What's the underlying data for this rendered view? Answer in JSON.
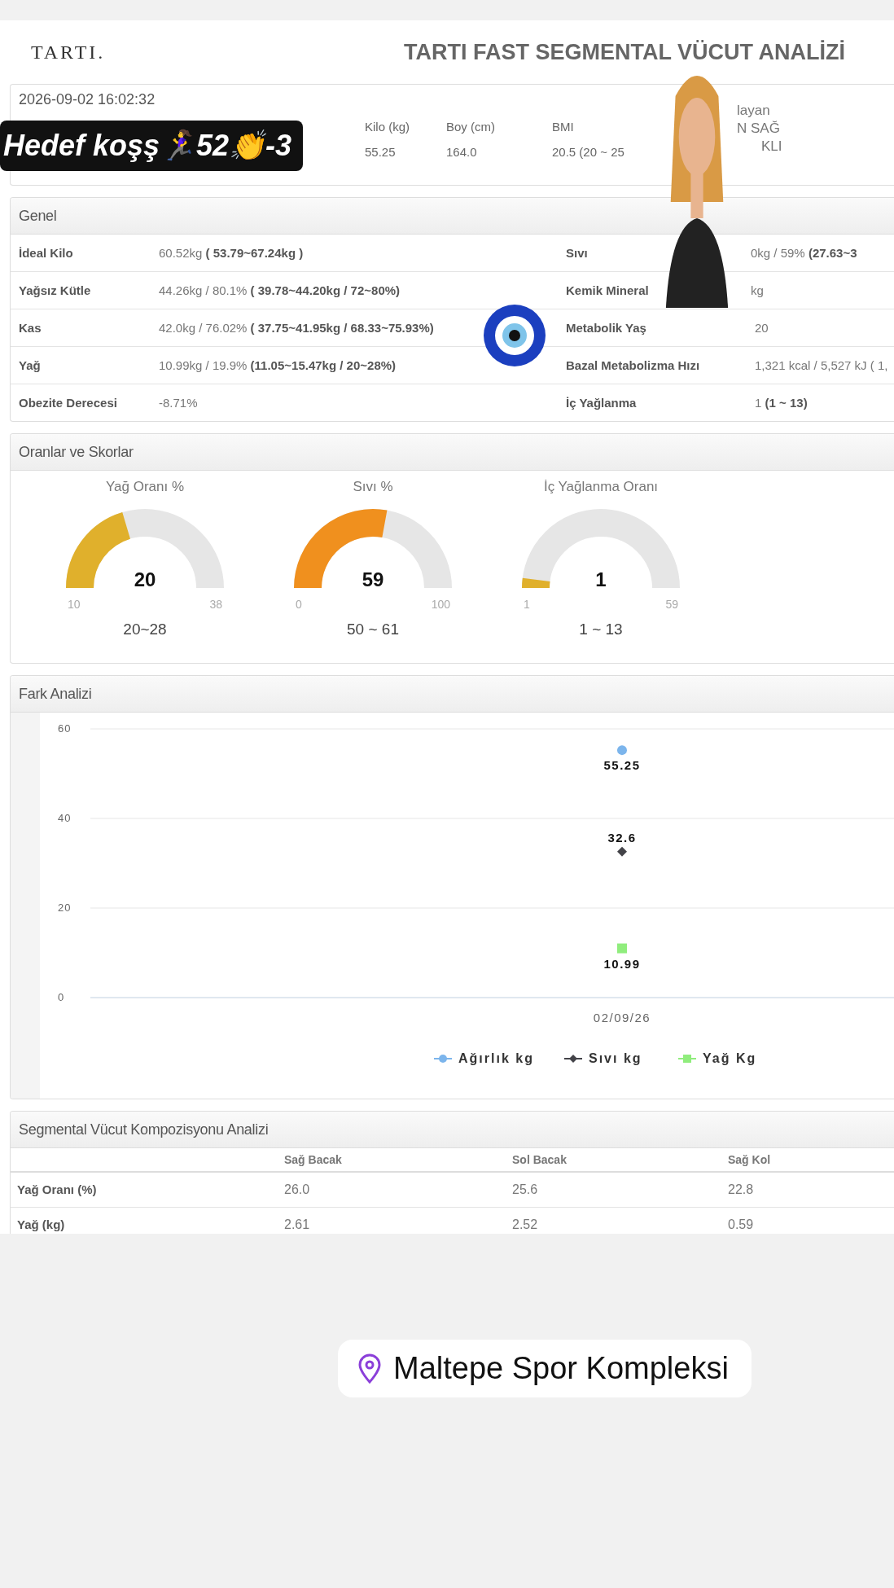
{
  "header": {
    "logo": "TARTI.",
    "title": "TARTI FAST SEGMENTAL VÜCUT ANALİZİ"
  },
  "info": {
    "date": "2026-09-02 16:02:32",
    "columns": [
      {
        "label": "Kilo (kg)",
        "value": "55.25"
      },
      {
        "label": "Boy (cm)",
        "value": "164.0"
      },
      {
        "label": "BMI",
        "value": "20.5 (20 ~ 25"
      }
    ],
    "column_4": [
      "layan",
      "N SAĞ",
      "KLI"
    ]
  },
  "sticker": {
    "text": "Hedef koşş🏃‍♀️52👏-3"
  },
  "genel": {
    "title": "Genel",
    "rows": [
      {
        "label": "İdeal Kilo",
        "value": "60.52kg **( 53.79~67.24kg )**",
        "label_2": "Sıvı",
        "value_2": "0kg / 59% **(27.63~3**"
      },
      {
        "label": "Yağsız Kütle",
        "value": "44.26kg / 80.1% **( 39.78~44.20kg / 72~80%)**",
        "label_2": "Kemik Mineral",
        "value_2": "kg"
      },
      {
        "label": "Kas",
        "value": "42.0kg / 76.02% **( 37.75~41.95kg / 68.33~75.93%)**",
        "label_2": "Metabolik Yaş",
        "value_2": "20"
      },
      {
        "label": "Yağ",
        "value": "10.99kg / 19.9% **(11.05~15.47kg / 20~28%)**",
        "label_2": "Bazal Metabolizma Hızı",
        "value_2": "1,321 kcal / 5,527 kJ ( 1,"
      },
      {
        "label": "Obezite Derecesi",
        "value": "-8.71%",
        "label_2": "İç Yağlanma",
        "value_2": "1 **(1 ~ 13)**"
      }
    ]
  },
  "scores": {
    "title": "Oranlar ve Skorlar",
    "gauges": [
      {
        "title": "Yağ Oranı %",
        "value": "20",
        "min": "10",
        "max": "38",
        "range": "20~28",
        "level": 0.357,
        "color": "#e0b02c"
      },
      {
        "title": "Sıvı %",
        "value": "59",
        "min": "0",
        "max": "100",
        "range": "50 ~ 61",
        "level": 0.59,
        "color": "#f0901e"
      },
      {
        "title": "İç Yağlanma Oranı",
        "value": "1",
        "min": "1",
        "max": "59",
        "range": "1 ~ 13",
        "level": 0,
        "color": "#e0b02c"
      }
    ]
  },
  "difference": {
    "title": "Fark Analizi",
    "chart_data": {
      "type": "scatter",
      "legend": "bottom",
      "categories": [
        "02/09/26"
      ],
      "ylim": [
        0,
        60
      ],
      "yticks": [
        0,
        20,
        40,
        60
      ],
      "data_labels": true,
      "series": [
        {
          "name": "Ağırlık kg",
          "color": "#7cb5ec",
          "values": [
            55.25
          ]
        },
        {
          "name": "Sıvı kg",
          "color": "#434348",
          "values": [
            32.6
          ]
        },
        {
          "name": "Yağ Kg",
          "color": "#90ed7d",
          "values": [
            10.99
          ]
        }
      ]
    }
  },
  "segmental": {
    "title": "Segmental Vücut Kompozisyonu Analizi",
    "columns": [
      "Sağ Bacak",
      "Sol Bacak",
      "Sağ Kol"
    ],
    "rows": [
      {
        "label": "Yağ Oranı (%)",
        "values": [
          "26.0",
          "25.6",
          "22.8"
        ]
      },
      {
        "label": "Yağ (kg)",
        "values": [
          "2.61",
          "2.52",
          "0.59"
        ]
      }
    ]
  },
  "location": {
    "text": "Maltepe Spor Kompleksi"
  }
}
